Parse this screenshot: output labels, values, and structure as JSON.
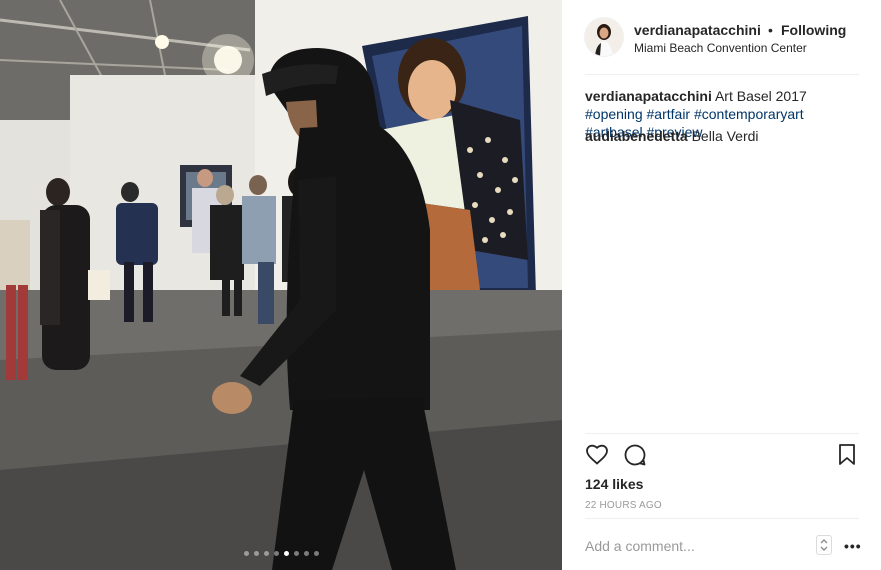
{
  "post": {
    "username": "verdianapatacchini",
    "separator": "•",
    "follow_status": "Following",
    "location": "Miami Beach Convention Center",
    "caption": {
      "author": "verdianapatacchini",
      "text": "Art Basel 2017",
      "hashtags": [
        "#opening",
        "#artfair",
        "#contemporaryart",
        "#artbasel",
        "#preview"
      ]
    },
    "comments": [
      {
        "author": "audiabenedetta",
        "text": "Bella Verdi"
      }
    ],
    "likes": "124 likes",
    "timestamp": "22 HOURS AGO",
    "add_comment_placeholder": "Add a comment...",
    "more_label": "•••"
  },
  "carousel": {
    "count": 8,
    "active_index": 4
  },
  "icons": {
    "like": "heart-icon",
    "comment": "speech-bubble-icon",
    "save": "bookmark-icon",
    "sort": "up-down-chevron-icon"
  },
  "colors": {
    "text": "#262626",
    "hashtag": "#003569",
    "muted": "#999999",
    "divider": "#efefef"
  }
}
